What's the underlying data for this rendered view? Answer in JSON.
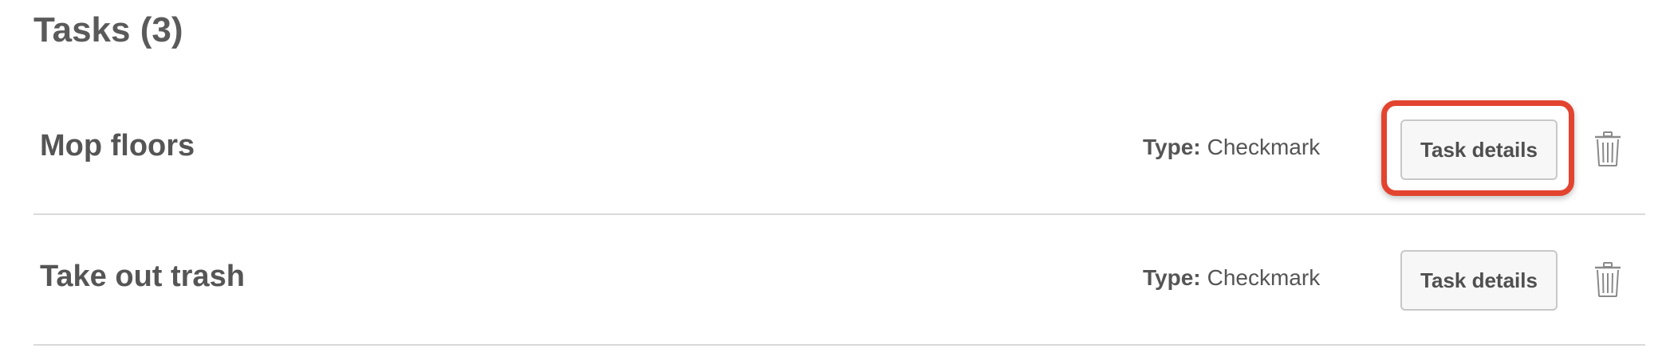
{
  "page": {
    "title": "Tasks (3)"
  },
  "tasks": [
    {
      "name": "Mop floors",
      "type_label": "Type:",
      "type_value": "Checkmark",
      "details_label": "Task details",
      "highlighted": true
    },
    {
      "name": "Take out trash",
      "type_label": "Type:",
      "type_value": "Checkmark",
      "details_label": "Task details",
      "highlighted": false
    }
  ],
  "icons": {
    "delete": "trash-icon"
  },
  "colors": {
    "highlight": "#e2442f",
    "text": "#555555",
    "divider": "#dadada",
    "button_bg": "#f7f7f7",
    "button_border": "#c8c8c8"
  }
}
